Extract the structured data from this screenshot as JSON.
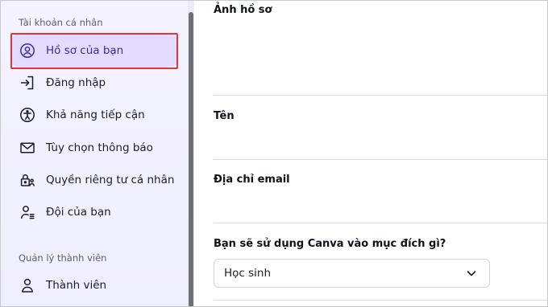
{
  "sidebar": {
    "personal_heading": "Tài khoản cá nhân",
    "items": [
      {
        "label": "Hồ sơ của bạn",
        "icon": "profile-circle-icon",
        "active": true
      },
      {
        "label": "Đăng nhập",
        "icon": "login-arrow-icon"
      },
      {
        "label": "Khả năng tiếp cận",
        "icon": "accessibility-icon"
      },
      {
        "label": "Tùy chọn thông báo",
        "icon": "envelope-icon"
      },
      {
        "label": "Quyền riêng tư cá nhân",
        "icon": "lock-person-icon"
      },
      {
        "label": "Đội của bạn",
        "icon": "team-member-icon"
      }
    ],
    "members_heading": "Quản lý thành viên",
    "member_items": [
      {
        "label": "Thành viên",
        "icon": "person-icon"
      }
    ]
  },
  "main": {
    "photo_label": "Ảnh hồ sơ",
    "name_label": "Tên",
    "email_label": "Địa chỉ email",
    "usage_label": "Bạn sẽ sử dụng Canva vào mục đích gì?",
    "usage_select": {
      "value": "Học sinh",
      "icon": "chevron-down-icon"
    }
  },
  "colors": {
    "sidebar_bg": "#f1f0ff",
    "active_bg": "#e3dcff",
    "active_text": "#3d2a9e",
    "highlight_border": "#e0353b"
  }
}
